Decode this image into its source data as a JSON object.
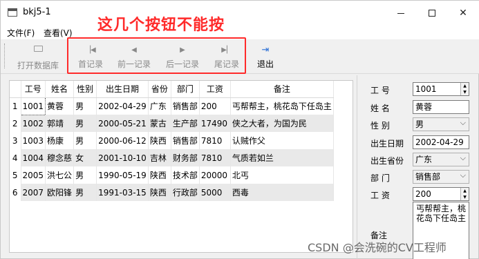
{
  "window": {
    "title": "bkj5-1",
    "minimize": "—",
    "maximize": "☐",
    "close": "✕"
  },
  "annotation": "这几个按钮不能按",
  "menu": {
    "file": "文件(F)",
    "view": "查看(V)"
  },
  "toolbar": {
    "open": "打开数据库",
    "first": "首记录",
    "prev": "前一记录",
    "next": "后一记录",
    "last": "尾记录",
    "exit": "退出"
  },
  "table": {
    "headers": [
      "工号",
      "姓名",
      "性别",
      "出生日期",
      "省份",
      "部门",
      "工资",
      "备注"
    ],
    "rows": [
      {
        "n": "1",
        "cells": [
          "1001",
          "黄蓉",
          "男",
          "2002-04-29",
          "广东",
          "销售部",
          "200",
          "丐帮帮主，桃花岛下任岛主"
        ]
      },
      {
        "n": "2",
        "cells": [
          "1002",
          "郭靖",
          "男",
          "2000-05-21",
          "蒙古",
          "生产部",
          "17490",
          "侠之大者，为国为民"
        ]
      },
      {
        "n": "3",
        "cells": [
          "1003",
          "杨康",
          "男",
          "2000-06-12",
          "陕西",
          "销售部",
          "7810",
          "认贼作父"
        ]
      },
      {
        "n": "4",
        "cells": [
          "1004",
          "穆念慈",
          "女",
          "2001-10-10",
          "吉林",
          "财务部",
          "7810",
          "气质若如兰"
        ]
      },
      {
        "n": "5",
        "cells": [
          "2005",
          "洪七公",
          "男",
          "1990-05-19",
          "陕西",
          "技术部",
          "20000",
          "北丐"
        ]
      },
      {
        "n": "6",
        "cells": [
          "2007",
          "欧阳锋",
          "男",
          "1991-03-15",
          "陕西",
          "行政部",
          "5000",
          "西毒"
        ]
      }
    ]
  },
  "form": {
    "id_label": "工    号",
    "id_value": "1001",
    "name_label": "姓    名",
    "name_value": "黄蓉",
    "gender_label": "性    别",
    "gender_value": "男",
    "birth_label": "出生日期",
    "birth_value": "2002-04-29",
    "province_label": "出生省份",
    "province_value": "广东",
    "dept_label": "部    门",
    "dept_value": "销售部",
    "salary_label": "工    资",
    "salary_value": "200",
    "memo_label": "备注",
    "memo_value": "丐帮帮主，桃花岛下任岛主"
  },
  "watermark": "CSDN @会洗碗的CV工程师",
  "colors": {
    "annotation": "#ff2a2a",
    "toolbar_disabled": "#8a8a8a",
    "exit_icon": "#2b6fd6"
  }
}
